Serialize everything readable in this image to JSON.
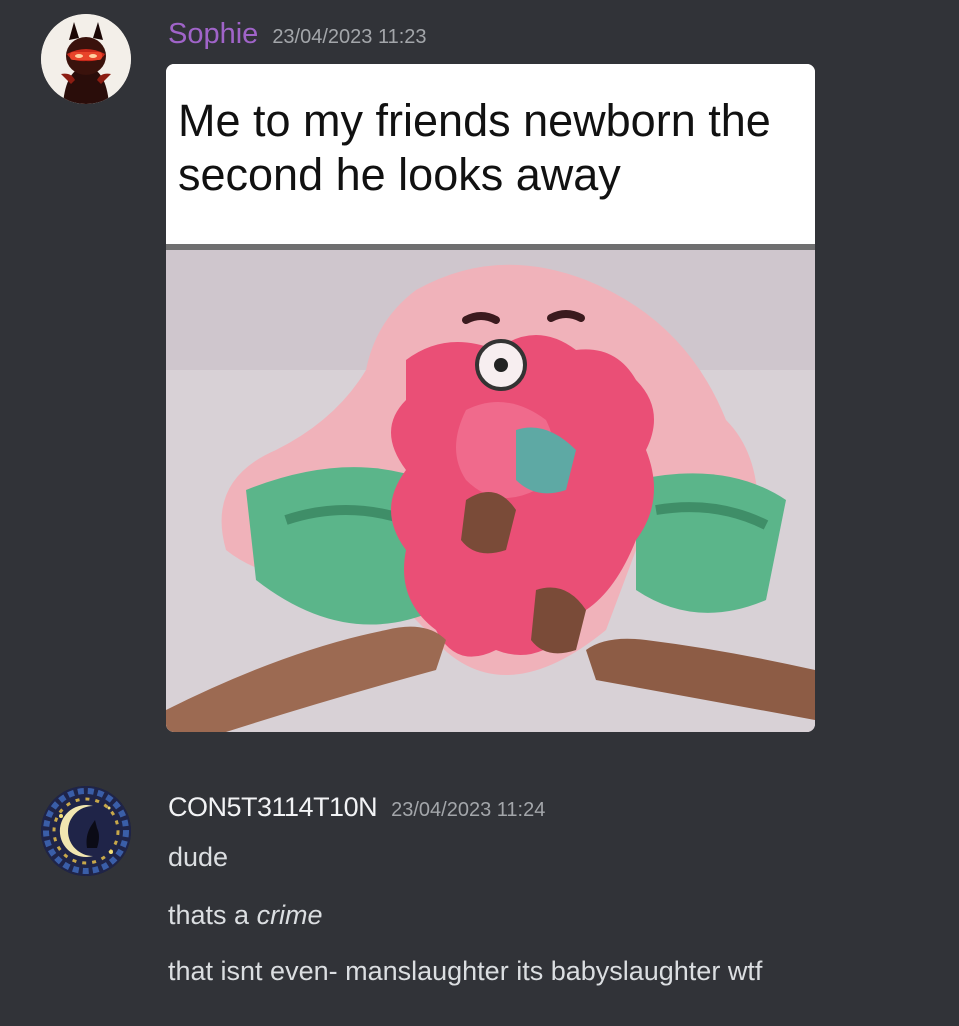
{
  "messages": [
    {
      "username": "Sophie",
      "timestamp": "23/04/2023 11:23",
      "avatar_icon": "red-devil-avatar-icon",
      "attachment": {
        "caption": "Me to my friends newborn the second he looks away"
      }
    },
    {
      "username": "CON5T3114T10N",
      "timestamp": "23/04/2023 11:24",
      "avatar_icon": "crescent-moon-cat-avatar-icon",
      "lines": [
        {
          "text": "dude"
        },
        {
          "prefix": "thats a ",
          "emphasis": "crime"
        },
        {
          "text": "that isnt even- manslaughter its babyslaughter wtf"
        }
      ]
    }
  ],
  "colors": {
    "background": "#313338",
    "username_sophie": "#a064c9",
    "username_const": "#f2f3f5",
    "timestamp": "#a3a6aa",
    "message_text": "#dbdee1"
  }
}
